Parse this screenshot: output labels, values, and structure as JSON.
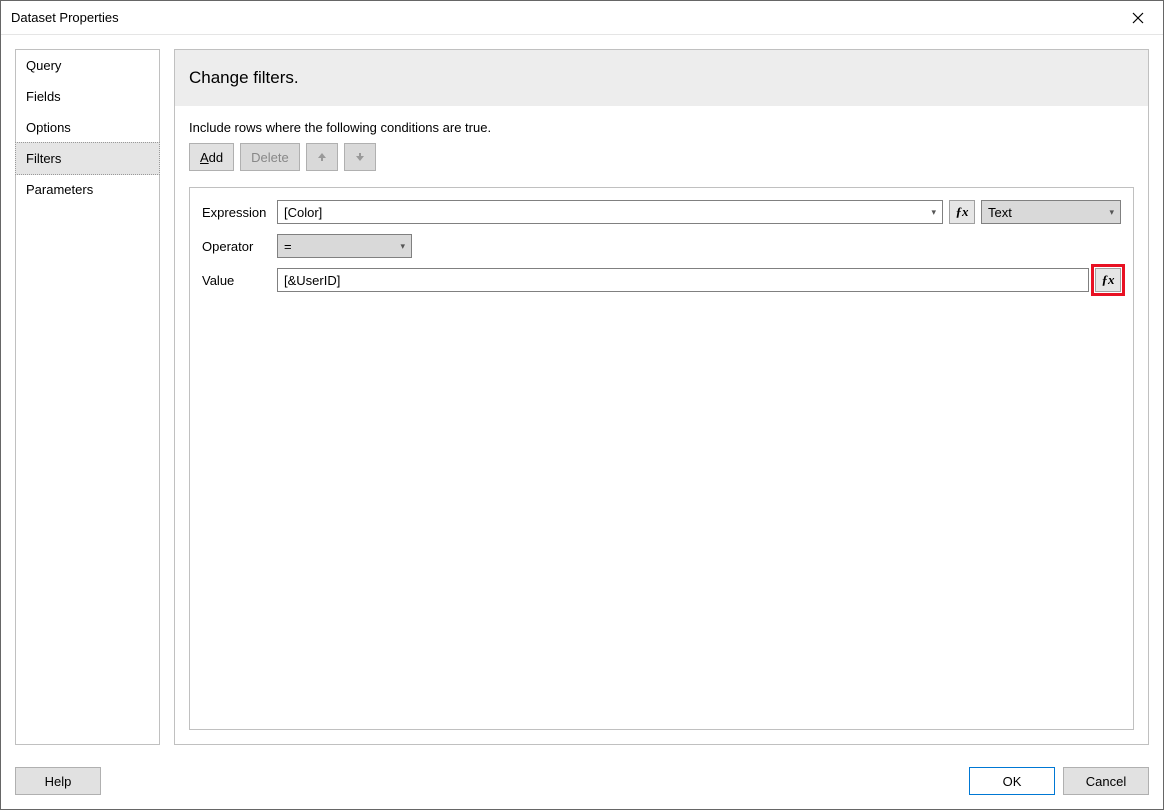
{
  "window_title": "Dataset Properties",
  "sidebar": {
    "items": [
      {
        "label": "Query",
        "selected": false
      },
      {
        "label": "Fields",
        "selected": false
      },
      {
        "label": "Options",
        "selected": false
      },
      {
        "label": "Filters",
        "selected": true
      },
      {
        "label": "Parameters",
        "selected": false
      }
    ]
  },
  "main": {
    "heading": "Change filters.",
    "description": "Include rows where the following conditions are true.",
    "toolbar": {
      "add": "Add",
      "delete": "Delete"
    },
    "labels": {
      "expression": "Expression",
      "operator": "Operator",
      "value": "Value"
    },
    "filter": {
      "expression": "[Color]",
      "type": "Text",
      "operator": "=",
      "value": "[&UserID]"
    }
  },
  "footer": {
    "help": "Help",
    "ok": "OK",
    "cancel": "Cancel"
  }
}
